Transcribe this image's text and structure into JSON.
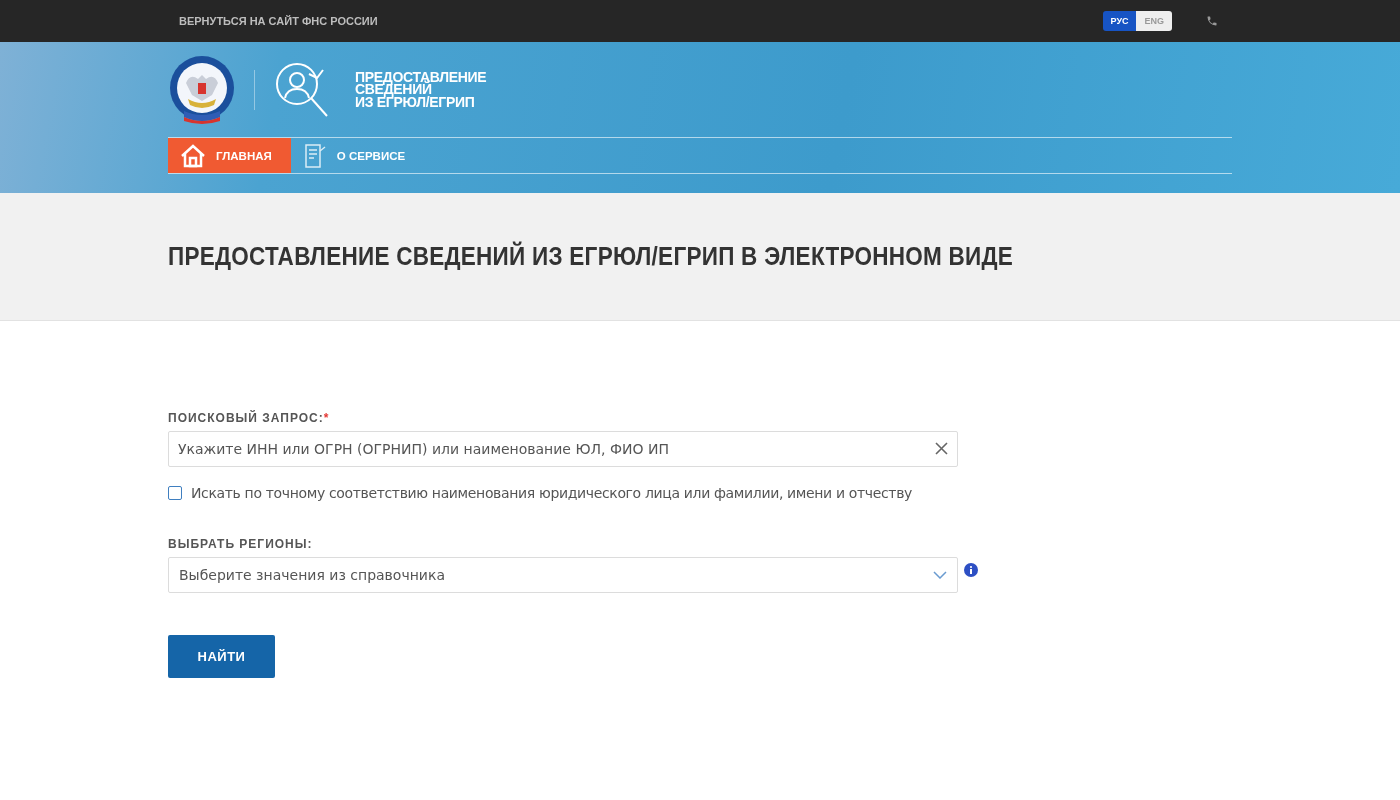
{
  "top_bar": {
    "back_link": "ВЕРНУТЬСЯ НА САЙТ ФНС РОССИИ",
    "languages": [
      {
        "label": "РУС",
        "selected": true
      },
      {
        "label": "ENG",
        "selected": false
      }
    ]
  },
  "header": {
    "service_title": [
      "ПРЕДОСТАВЛЕНИЕ",
      "СВЕДЕНИЙ",
      "ИЗ ЕГРЮЛ/ЕГРИП"
    ],
    "nav": [
      {
        "label": "ГЛАВНАЯ",
        "kind": "home",
        "selected": true
      },
      {
        "label": "О СЕРВИСЕ",
        "kind": "about",
        "selected": false
      }
    ]
  },
  "page_title": "ПРЕДОСТАВЛЕНИЕ СВЕДЕНИЙ ИЗ ЕГРЮЛ/ЕГРИП В ЭЛЕКТРОННОМ ВИДЕ",
  "form": {
    "query_label": "ПОИСКОВЫЙ ЗАПРОС:",
    "required_mark": "*",
    "query_placeholder": "Укажите ИНН или ОГРН (ОГРНИП) или наименование ЮЛ, ФИО ИП",
    "exact_match": {
      "label": "Искать по точному соответствию наименования юридического лица или фамилии, имени и отчеству",
      "checked": false
    },
    "regions_label": "ВЫБРАТЬ РЕГИОНЫ:",
    "regions_placeholder": "Выберите значения из справочника",
    "submit": "НАЙТИ"
  }
}
